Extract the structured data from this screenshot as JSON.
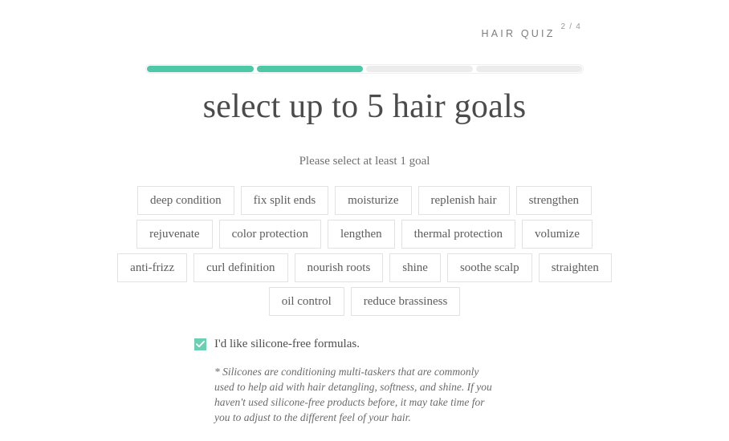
{
  "header": {
    "quiz_label": "HAIR QUIZ",
    "step_indicator": "2 / 4"
  },
  "progress": {
    "total_segments": 4,
    "filled_segments": 2,
    "filled_color": "#4dc9a8",
    "empty_color": "#ececec"
  },
  "main": {
    "title": "select up to 5 hair goals",
    "subtitle": "Please select at least 1 goal",
    "goal_rows": [
      [
        "deep condition",
        "fix split ends",
        "moisturize",
        "replenish hair",
        "strengthen"
      ],
      [
        "rejuvenate",
        "color protection",
        "lengthen",
        "thermal protection",
        "volumize"
      ],
      [
        "anti-frizz",
        "curl definition",
        "nourish roots",
        "shine",
        "soothe scalp",
        "straighten"
      ],
      [
        "oil control",
        "reduce brassiness"
      ]
    ]
  },
  "silicone": {
    "checked": true,
    "checkbox_color": "#6ccfb4",
    "label": "I'd like silicone-free formulas.",
    "note": "* Silicones are conditioning multi-taskers that are commonly used to help aid with hair detangling, softness, and shine. If you haven't used silicone-free products before, it may take time for you to adjust to the different feel of your hair."
  }
}
